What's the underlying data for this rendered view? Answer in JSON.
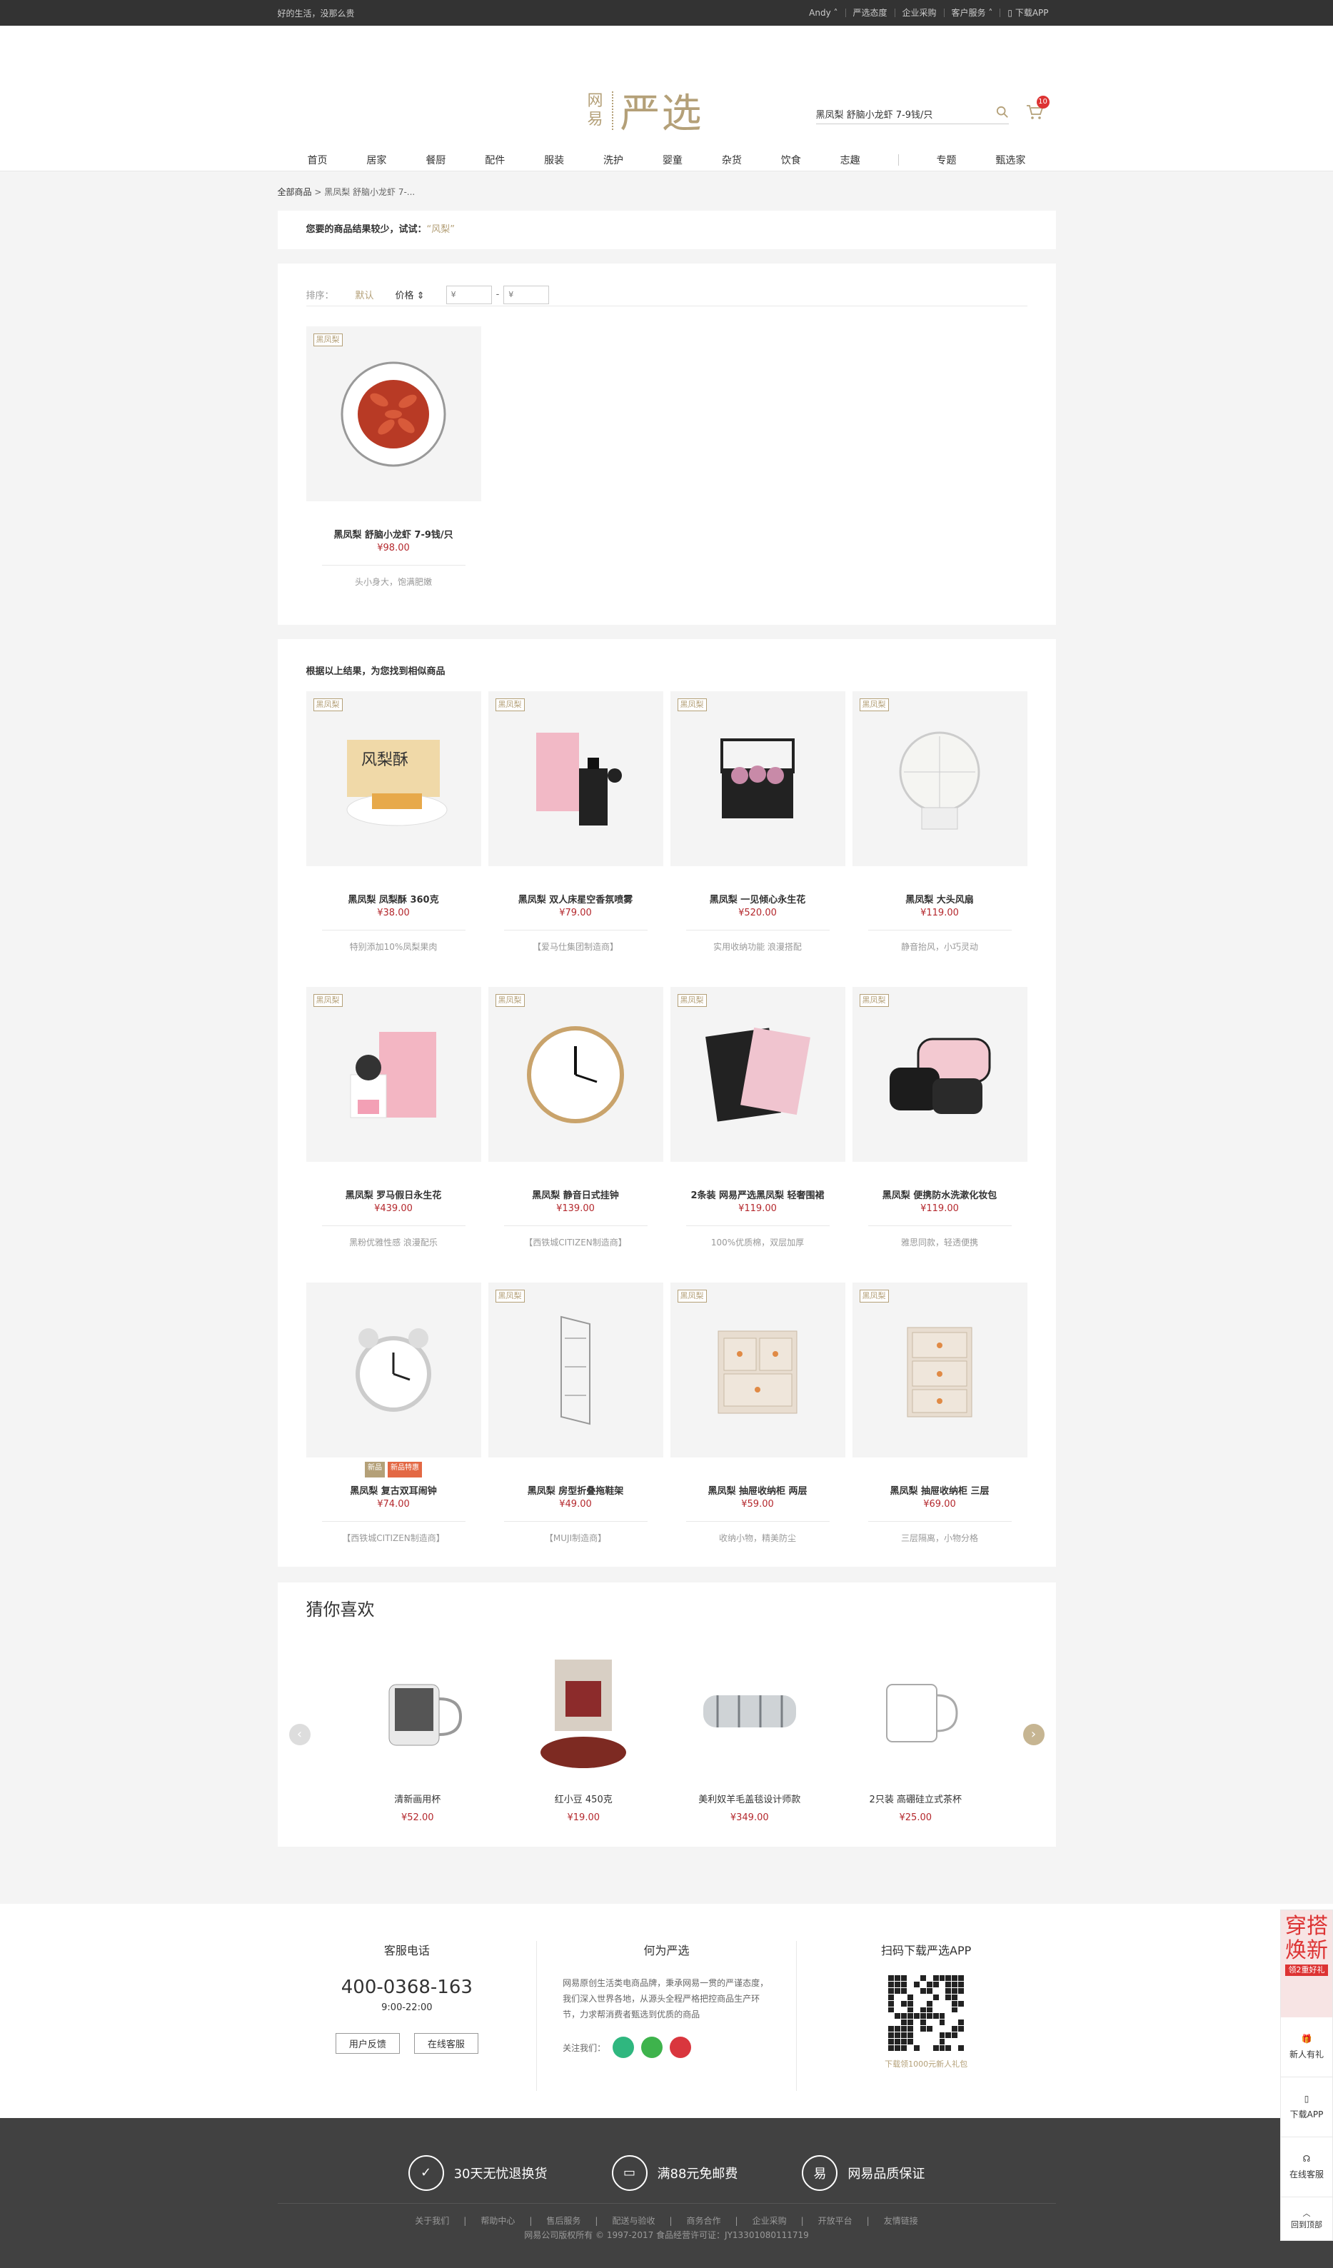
{
  "topbar": {
    "slogan": "好的生活，没那么贵",
    "user": "Andy",
    "links": [
      "严选态度",
      "企业采购",
      "客户服务",
      "下载APP"
    ]
  },
  "header": {
    "logo_small_1": "网",
    "logo_small_2": "易",
    "logo_big": "严选",
    "search_value": "黑凤梨 舒脑小龙虾 7-9钱/只",
    "cart_count": "10"
  },
  "nav": [
    "首页",
    "居家",
    "餐厨",
    "配件",
    "服装",
    "洗护",
    "婴童",
    "杂货",
    "饮食",
    "志趣",
    "专题",
    "甄选家"
  ],
  "breadcrumb": {
    "root": "全部商品",
    "current": "黑凤梨 舒脑小龙虾 7-..."
  },
  "notice": {
    "text": "您要的商品结果较少，试试：",
    "keyword": "“风梨”"
  },
  "sort": {
    "label": "排序：",
    "default": "默认",
    "price": "价格",
    "min_placeholder": "¥",
    "dash": "-",
    "max_placeholder": "¥"
  },
  "results": [
    {
      "tag": "黑凤梨",
      "name": "黑凤梨 舒脑小龙虾 7-9钱/只",
      "price": "¥98.00",
      "desc": "头小身大，饱满肥嫩",
      "img": "crayfish"
    }
  ],
  "similar": {
    "title": "根据以上结果，为您找到相似商品",
    "items": [
      {
        "tag": "黑凤梨",
        "name": "黑凤梨 凤梨酥 360克",
        "price": "¥38.00",
        "desc": "特别添加10%凤梨果肉",
        "img": "cake"
      },
      {
        "tag": "黑凤梨",
        "name": "黑凤梨 双人床星空香氛喷雾",
        "price": "¥79.00",
        "desc": "【爱马仕集团制造商】",
        "img": "perfume"
      },
      {
        "tag": "黑凤梨",
        "name": "黑凤梨 一见倾心永生花",
        "price": "¥520.00",
        "desc": "实用收纳功能 浪漫搭配",
        "img": "flowerbox"
      },
      {
        "tag": "黑凤梨",
        "name": "黑凤梨 大头风扇",
        "price": "¥119.00",
        "desc": "静音抬风，小巧灵动",
        "img": "fan"
      },
      {
        "tag": "黑凤梨",
        "name": "黑凤梨 罗马假日永生花",
        "price": "¥439.00",
        "desc": "黑粉优雅性感 浪漫配乐",
        "img": "pinkbox"
      },
      {
        "tag": "黑凤梨",
        "name": "黑凤梨 静音日式挂钟",
        "price": "¥139.00",
        "desc": "【西铁城CITIZEN制造商】",
        "img": "clock"
      },
      {
        "tag": "黑凤梨",
        "name": "2条装 网易严选黑凤梨 轻奢围裙",
        "price": "¥119.00",
        "desc": "100%优质棉，双层加厚",
        "img": "apron"
      },
      {
        "tag": "黑凤梨",
        "name": "黑凤梨 便携防水洗漱化妆包",
        "price": "¥119.00",
        "desc": "雅思同款，轻透便携",
        "img": "bags"
      },
      {
        "tag": "",
        "badges": [
          "新品",
          "新品特惠"
        ],
        "name": "黑凤梨 复古双耳闹钟",
        "price": "¥74.00",
        "desc": "【西铁城CITIZEN制造商】",
        "img": "alarm"
      },
      {
        "tag": "黑凤梨",
        "name": "黑凤梨 房型折叠拖鞋架",
        "price": "¥49.00",
        "desc": "【MUJI制造商】",
        "img": "rack"
      },
      {
        "tag": "黑凤梨",
        "name": "黑凤梨 抽屉收纳柜 两层",
        "price": "¥59.00",
        "desc": "收纳小物，精美防尘",
        "img": "drawer2"
      },
      {
        "tag": "黑凤梨",
        "name": "黑凤梨 抽屉收纳柜 三层",
        "price": "¥69.00",
        "desc": "三层隔离，小物分格",
        "img": "drawer3"
      }
    ]
  },
  "likes": {
    "title": "猜你喜欢",
    "items": [
      {
        "name": "清新画用杯",
        "price": "¥52.00",
        "img": "teacup"
      },
      {
        "name": "红小豆 450克",
        "price": "¥19.00",
        "img": "beans"
      },
      {
        "name": "美利奴羊毛盖毯设计师款",
        "price": "¥349.00",
        "img": "blanket"
      },
      {
        "name": "2只装 高硼硅立式茶杯",
        "price": "¥25.00",
        "img": "glass"
      }
    ]
  },
  "footer": {
    "service_title": "客服电话",
    "phone": "400-0368-163",
    "hours": "9:00-22:00",
    "feedback": "用户反馈",
    "online": "在线客服",
    "about_title": "何为严选",
    "about": "网易原创生活类电商品牌，秉承网易一贯的严谨态度，我们深入世界各地，从源头全程严格把控商品生产环节，力求帮消费者甄选到优质的商品",
    "follow": "关注我们：",
    "app_title": "扫码下载严选APP",
    "app_gift": "下载领1000元新人礼包"
  },
  "bottom": {
    "features": [
      "30天无忧退换货",
      "满88元免邮费",
      "网易品质保证"
    ],
    "links": [
      "关于我们",
      "帮助中心",
      "售后服务",
      "配送与验收",
      "商务合作",
      "企业采购",
      "开放平台",
      "友情链接"
    ],
    "copyright": "网易公司版权所有 © 1997-2017   食品经营许可证：JY13301080111719"
  },
  "sidebar": {
    "ad_1": "穿搭",
    "ad_2": "焕新",
    "ad_sub": "领2重好礼",
    "gift": "新人有礼",
    "app": "下载APP",
    "service": "在线客服",
    "top": "回到顶部"
  },
  "colors": {
    "accent": "#b4a078",
    "price": "#b4282d",
    "dark": "#333333"
  }
}
